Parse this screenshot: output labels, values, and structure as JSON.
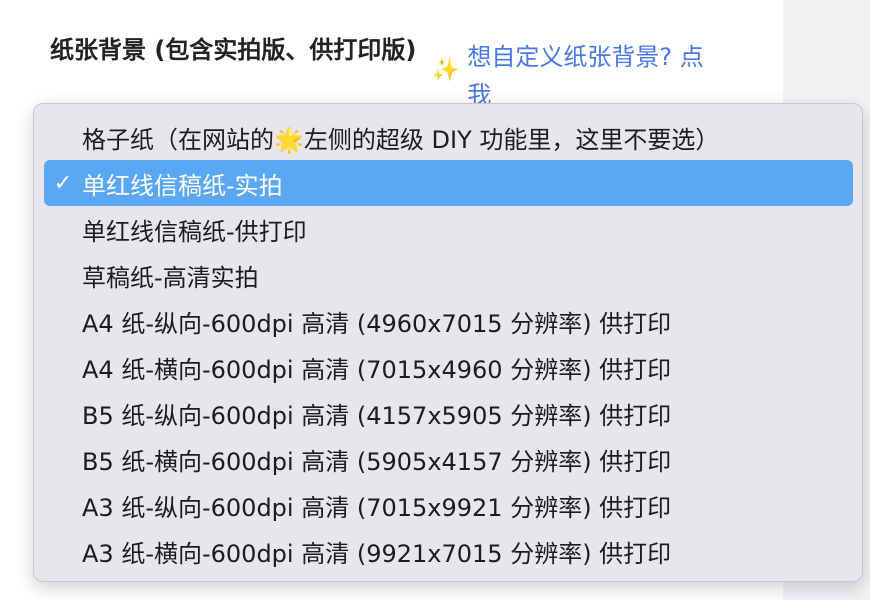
{
  "field": {
    "label": "纸张背景 (包含实拍版、供打印版)"
  },
  "custom_background_link": {
    "icon": "sparkles-icon",
    "text": "想自定义纸张背景? 点我"
  },
  "dropdown": {
    "options": [
      {
        "label_before": "格子纸（在网站的",
        "icon": "star-icon",
        "label_after": "左侧的超级 DIY 功能里，这里不要选）",
        "selected": false
      },
      {
        "label": "单红线信稿纸-实拍",
        "selected": true
      },
      {
        "label": "单红线信稿纸-供打印",
        "selected": false
      },
      {
        "label": "草稿纸-高清实拍",
        "selected": false
      },
      {
        "label": "A4 纸-纵向-600dpi 高清 (4960x7015 分辨率) 供打印",
        "selected": false
      },
      {
        "label": "A4 纸-横向-600dpi 高清 (7015x4960 分辨率) 供打印",
        "selected": false
      },
      {
        "label": "B5 纸-纵向-600dpi 高清 (4157x5905 分辨率) 供打印",
        "selected": false
      },
      {
        "label": "B5 纸-横向-600dpi 高清 (5905x4157 分辨率) 供打印",
        "selected": false
      },
      {
        "label": "A3 纸-纵向-600dpi 高清 (7015x9921 分辨率) 供打印",
        "selected": false
      },
      {
        "label": "A3 纸-横向-600dpi 高清 (9921x7015 分辨率) 供打印",
        "selected": false
      }
    ],
    "check_mark": "✓",
    "selected_color": "#5aa7f3"
  }
}
